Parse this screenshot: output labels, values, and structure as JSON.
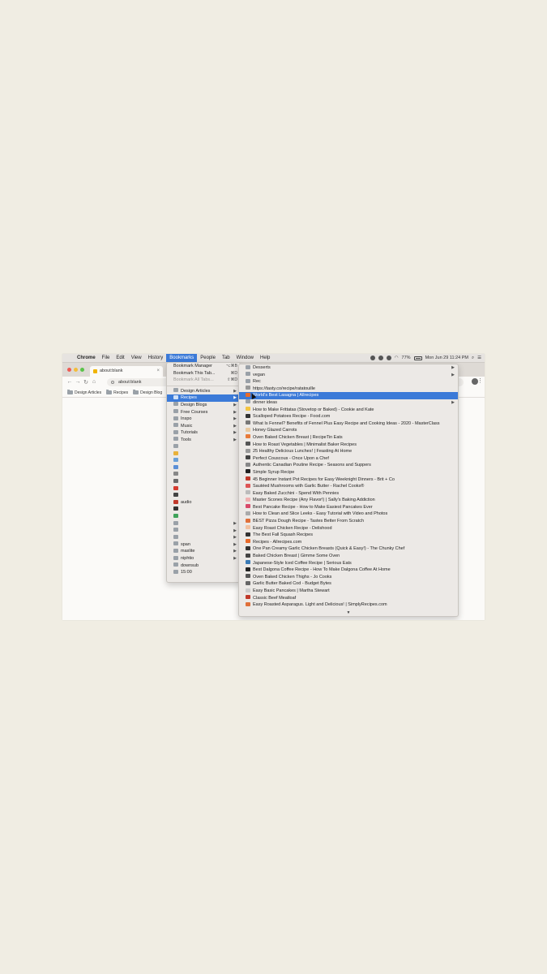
{
  "menubar": {
    "items": [
      "Chrome",
      "File",
      "Edit",
      "View",
      "History",
      "Bookmarks",
      "People",
      "Tab",
      "Window",
      "Help"
    ],
    "active": "Bookmarks",
    "battery": "77%",
    "clock": "Mon Jun 29  11:24 PM"
  },
  "browser": {
    "tab_title": "about:blank",
    "address": "about:blank",
    "bookmarks_bar": [
      "Design Articles",
      "Recipes",
      "Design Blog"
    ]
  },
  "bookmarks_menu": {
    "commands": [
      {
        "label": "Bookmark Manager",
        "shortcut": "⌥⌘B"
      },
      {
        "label": "Bookmark This Tab...",
        "shortcut": "⌘D"
      },
      {
        "label": "Bookmark All Tabs...",
        "shortcut": "⇧⌘D",
        "disabled": true
      }
    ],
    "folders": [
      {
        "label": "Design Articles",
        "submenu": true
      },
      {
        "label": "Recipes",
        "submenu": true,
        "highlighted": true
      },
      {
        "label": "Design Blogs",
        "submenu": true
      },
      {
        "label": "Free Courses",
        "submenu": true
      },
      {
        "label": "Inspo",
        "submenu": true
      },
      {
        "label": "Music",
        "submenu": true
      },
      {
        "label": "Tutorials",
        "submenu": true
      },
      {
        "label": "Tools",
        "submenu": true
      }
    ],
    "icon_rows": [
      {
        "label": "",
        "color": "#9aa1a8"
      },
      {
        "label": "",
        "color": "#e8b13a"
      },
      {
        "label": "",
        "color": "#6aa0d8"
      },
      {
        "label": "",
        "color": "#5b8fd6"
      },
      {
        "label": "",
        "color": "#888"
      },
      {
        "label": "",
        "color": "#6a6a6a"
      },
      {
        "label": "",
        "color": "#d53b2f"
      },
      {
        "label": "",
        "color": "#444"
      },
      {
        "label": "audio",
        "color": "#c0392b"
      },
      {
        "label": "",
        "color": "#333"
      },
      {
        "label": "",
        "color": "#3fa35a"
      }
    ],
    "bottom_rows": [
      {
        "label": "",
        "submenu": true
      },
      {
        "label": "",
        "submenu": true
      },
      {
        "label": "",
        "submenu": true
      },
      {
        "label": "span",
        "submenu": true
      },
      {
        "label": "maxlite",
        "submenu": true
      },
      {
        "label": "niphtio",
        "submenu": true
      },
      {
        "label": "downsub",
        "submenu": false
      },
      {
        "label": "15:00",
        "submenu": false
      }
    ]
  },
  "recipes_submenu": {
    "folders": [
      {
        "label": "Desserts",
        "submenu": true
      },
      {
        "label": "vegan",
        "submenu": true
      },
      {
        "label": "Rec",
        "submenu": false
      }
    ],
    "items": [
      {
        "label": "https://tasty.co/recipe/ratatouille",
        "color": "#999"
      },
      {
        "label": "World's Best Lasagna | Allrecipes",
        "color": "#e86a2a",
        "highlighted": true
      },
      {
        "label": "dinner ideas",
        "color": "#9aa1a8",
        "submenu": true
      },
      {
        "label": "How to Make Frittatas (Stovetop or Baked) - Cookie and Kate",
        "color": "#f4c542"
      },
      {
        "label": "Scalloped Potatoes Recipe - Food.com",
        "color": "#333"
      },
      {
        "label": "What Is Fennel? Benefits of Fennel Plus Easy Recipe and Cooking Ideas - 2020 - MasterClass",
        "color": "#777"
      },
      {
        "label": "Honey Glazed Carrots",
        "color": "#e9c9a0"
      },
      {
        "label": "Oven Baked Chicken Breast | RecipeTin Eats",
        "color": "#e87a3a"
      },
      {
        "label": "How to Roast Vegetables | Minimalist Baker Recipes",
        "color": "#555"
      },
      {
        "label": "25 Healthy Delicious Lunches! | Feasting At Home",
        "color": "#999"
      },
      {
        "label": "Perfect Couscous - Once Upon a Chef",
        "color": "#444"
      },
      {
        "label": "Authentic Canadian Poutine Recipe - Seasons and Suppers",
        "color": "#888"
      },
      {
        "label": "Simple Syrup Recipe",
        "color": "#222"
      },
      {
        "label": "45 Beginner Instant Pot Recipes for Easy Weeknight Dinners - Brit + Co",
        "color": "#c0392b"
      },
      {
        "label": "Sautéed Mushrooms with Garlic Butter - Rachel Cooks®",
        "color": "#d55"
      },
      {
        "label": "Easy Baked Zucchini - Spend With Pennies",
        "color": "#bbb"
      },
      {
        "label": "Master Scones Recipe (Any Flavor!) | Sally's Baking Addiction",
        "color": "#f0b0b0"
      },
      {
        "label": "Best Pancake Recipe - How to Make Easiest Pancakes Ever",
        "color": "#d84a6a"
      },
      {
        "label": "How to Clean and Slice Leeks - Easy Tutorial with Video and Photos",
        "color": "#aaa"
      },
      {
        "label": "BEST Pizza Dough Recipe - Tastes Better From Scratch",
        "color": "#e0703a"
      },
      {
        "label": "Easy Roast Chicken Recipe - Delishood",
        "color": "#f2c0a0"
      },
      {
        "label": "The Best Fall Squash Recipes",
        "color": "#333"
      },
      {
        "label": "Recipes - Allrecipes.com",
        "color": "#e86a2a"
      },
      {
        "label": "One Pan Creamy Garlic Chicken Breasts (Quick & Easy!) - The Chunky Chef",
        "color": "#333"
      },
      {
        "label": "Baked Chicken Breast | Gimme Some Oven",
        "color": "#444"
      },
      {
        "label": "Japanese-Style Iced Coffee Recipe | Serious Eats",
        "color": "#3a7ab5"
      },
      {
        "label": "Best Dalgona Coffee Recipe - How To Make Dalgona Coffee At Home",
        "color": "#222"
      },
      {
        "label": "Oven Baked Chicken Thighs - Jo Cooks",
        "color": "#555"
      },
      {
        "label": "Garlic Butter Baked Cod - Budget Bytes",
        "color": "#666"
      },
      {
        "label": "Easy Basic Pancakes | Martha Stewart",
        "color": "#ccc"
      },
      {
        "label": "Classic Beef Meatloaf",
        "color": "#c0392b"
      },
      {
        "label": "Easy Roasted Asparagus. Light and Delicious! | SimplyRecipes.com",
        "color": "#e0703a"
      }
    ],
    "scroll_indicator": "▼"
  }
}
